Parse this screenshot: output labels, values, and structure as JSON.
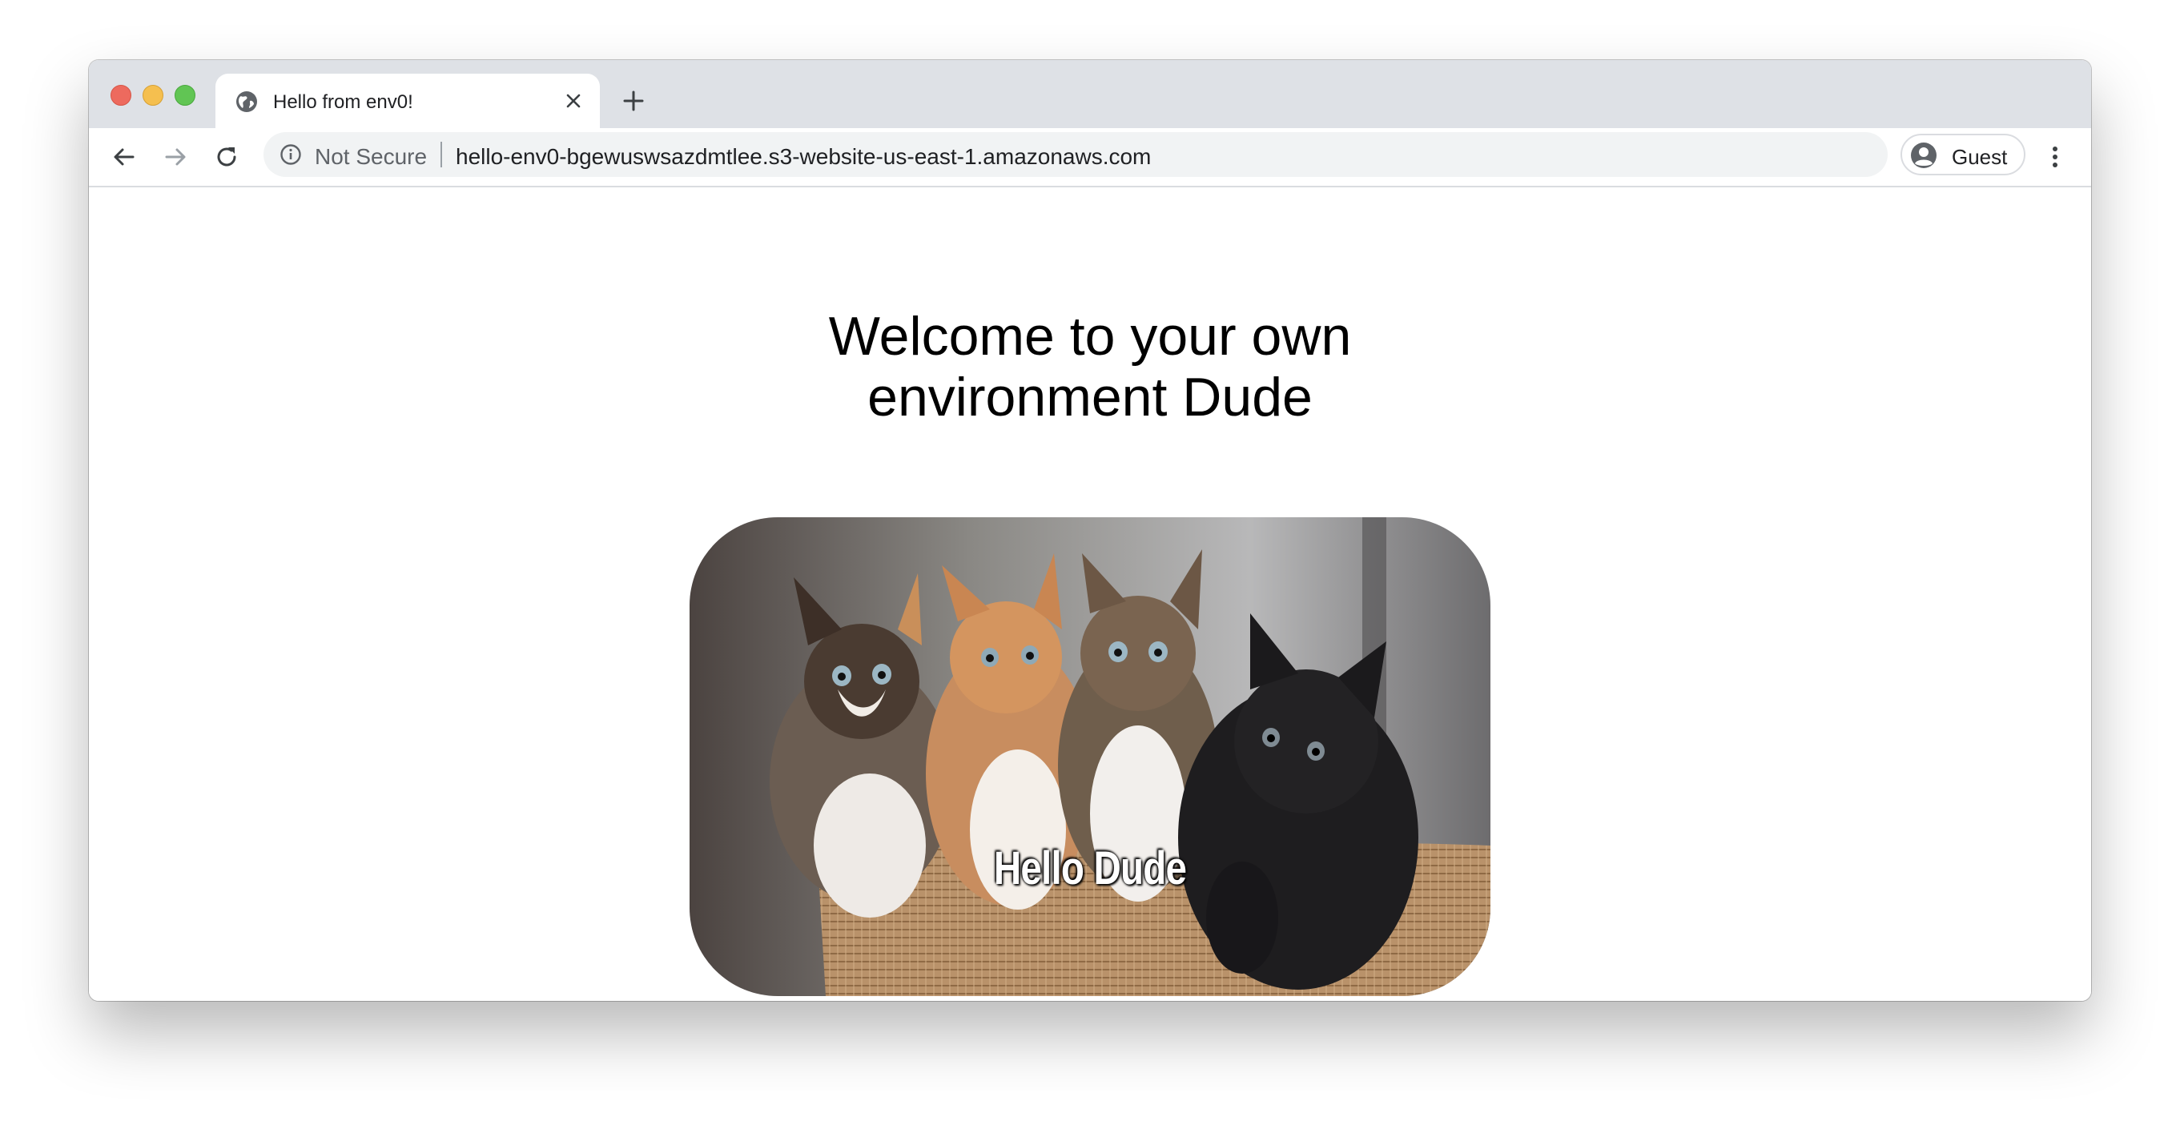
{
  "browser": {
    "tab": {
      "title": "Hello from env0!",
      "icon": "globe-icon"
    },
    "toolbar": {
      "security_label": "Not Secure",
      "url": "hello-env0-bgewuswsazdmtlee.s3-website-us-east-1.amazonaws.com",
      "profile_label": "Guest"
    },
    "colors": {
      "tabstrip": "#dee1e6",
      "omnibox": "#f1f3f4",
      "traffic_close": "#ed6a5e",
      "traffic_minimize": "#f5bf4f",
      "traffic_maximize": "#61c554"
    }
  },
  "page": {
    "heading": "Welcome to your own environment Dude",
    "image": {
      "description": "kittens-in-basket",
      "caption": "Hello Dude"
    }
  }
}
